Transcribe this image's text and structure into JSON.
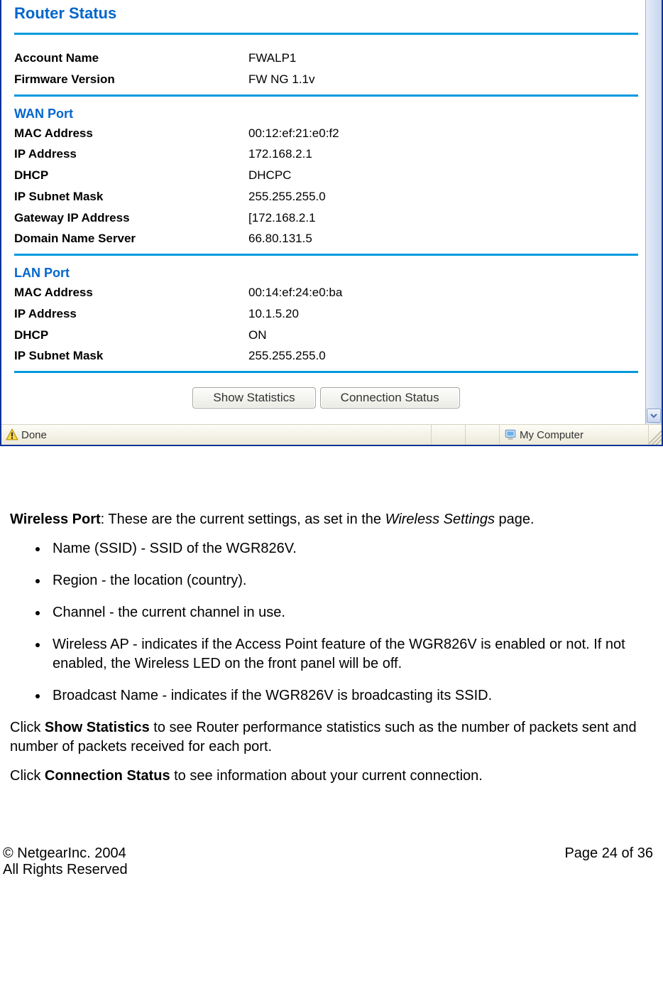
{
  "router_panel": {
    "title": "Router Status",
    "account": {
      "name_label": "Account Name",
      "name_value": "FWALP1",
      "fw_label": "Firmware Version",
      "fw_value": "FW NG 1.1v"
    },
    "wan": {
      "heading": "WAN Port",
      "rows": [
        {
          "label": "MAC Address",
          "value": "00:12:ef:21:e0:f2"
        },
        {
          "label": "IP Address",
          "value": "172.168.2.1"
        },
        {
          "label": "DHCP",
          "value": "DHCPC"
        },
        {
          "label": "IP Subnet Mask",
          "value": "255.255.255.0"
        },
        {
          "label": "Gateway IP Address",
          "value": "[172.168.2.1"
        },
        {
          "label": "Domain Name Server",
          "value": "66.80.131.5"
        }
      ]
    },
    "lan": {
      "heading": "LAN Port",
      "rows": [
        {
          "label": "MAC Address",
          "value": "00:14:ef:24:e0:ba"
        },
        {
          "label": "IP Address",
          "value": "10.1.5.20"
        },
        {
          "label": "DHCP",
          "value": "ON"
        },
        {
          "label": "IP Subnet Mask",
          "value": "255.255.255.0"
        }
      ]
    },
    "buttons": {
      "stats": "Show Statistics",
      "conn": "Connection Status"
    }
  },
  "status_bar": {
    "done": "Done",
    "zone": "My Computer"
  },
  "doc": {
    "wireless_heading": "Wireless Port",
    "wireless_intro": ": These are the current settings, as set in the ",
    "wireless_intro_em": "Wireless Settings",
    "wireless_intro_tail": " page.",
    "bullets": [
      "Name (SSID) - SSID of the WGR826V.",
      "Region - the location (country).",
      "Channel - the current channel in use.",
      "Wireless AP - indicates if the Access Point feature of the WGR826V is enabled or not. If not enabled, the Wireless LED on the front panel will be off.",
      "Broadcast Name - indicates if the WGR826V is broadcasting its SSID."
    ],
    "p_stats_pre": "Click ",
    "p_stats_bold": "Show Statistics",
    "p_stats_post": " to see Router performance statistics such as the number of packets sent and number of packets received for each port.",
    "p_conn_pre": "Click ",
    "p_conn_bold": "Connection Status",
    "p_conn_post": " to see information about your current connection."
  },
  "footer": {
    "copyright": "© NetgearInc. 2004",
    "rights": "All Rights Reserved",
    "page": "Page 24 of 36"
  }
}
